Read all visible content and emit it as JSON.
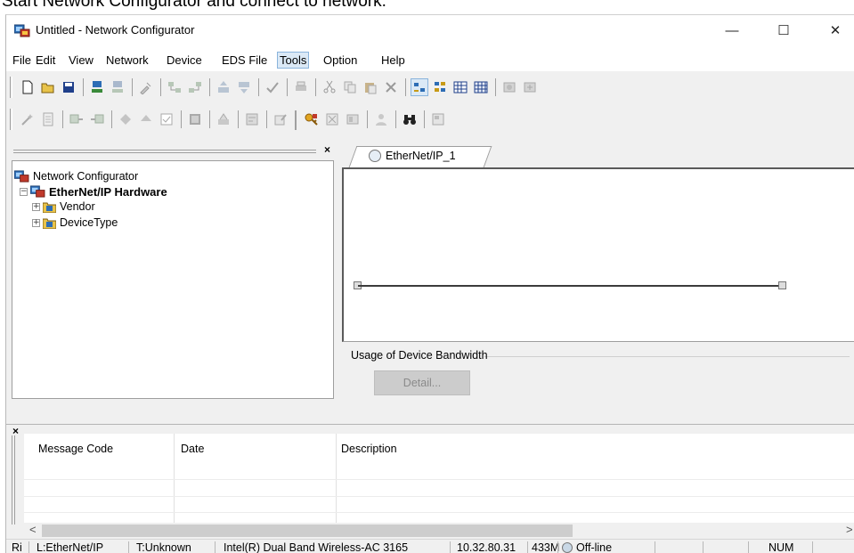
{
  "caption": "Start Network Configurator and connect to network.",
  "window": {
    "title": "Untitled - Network Configurator",
    "controls": {
      "minimize": "—",
      "maximize": "☐",
      "close": "✕"
    }
  },
  "menu": [
    "File",
    "Edit",
    "View",
    "Network",
    "Device",
    "EDS File",
    "Tools",
    "Option",
    "Help"
  ],
  "tree": {
    "root": "Network Configurator",
    "hardware": "EtherNet/IP Hardware",
    "children": [
      "Vendor",
      "DeviceType"
    ],
    "expander": "+",
    "close": "×"
  },
  "tab": {
    "label": "EtherNet/IP_1"
  },
  "bandwidth": {
    "label": "Usage of Device Bandwidth",
    "detail_button": "Detail..."
  },
  "messages": {
    "close": "×",
    "columns": [
      "Message Code",
      "Date",
      "Description"
    ],
    "scroll_left": "<",
    "scroll_right": ">"
  },
  "status": {
    "s0": "Ri",
    "s1": "L:EtherNet/IP",
    "s2": "T:Unknown",
    "s3": "Intel(R) Dual Band Wireless-AC 3165",
    "s4": "10.32.80.31",
    "s5": "433M",
    "s6": "Off-line",
    "s7": "NUM"
  },
  "icons": {
    "app": "network-configurator-icon",
    "toolbar1": [
      "new-icon",
      "open-icon",
      "save-icon",
      "connect-icon",
      "disconnect-icon",
      "tool-icon",
      "network-icon",
      "network2-icon",
      "upload-icon",
      "download-icon",
      "check-icon",
      "print-icon",
      "cut-icon",
      "copy-icon",
      "paste-icon",
      "delete-icon",
      "view-icon",
      "view2-icon",
      "grid-icon",
      "grid2-icon",
      "device-icon",
      "device2-icon"
    ],
    "toolbar2": [
      "wizard-icon",
      "doc-icon",
      "param-icon",
      "param2-icon",
      "arrow-icon",
      "arrow2-icon",
      "checkbox-icon",
      "monitor-icon",
      "parameter-icon",
      "register-icon",
      "edit-icon",
      "key-icon",
      "error-icon",
      "io-icon",
      "person-icon",
      "binoculars-icon",
      "properties-icon"
    ]
  },
  "colors": {
    "window_bg": "#f0f0f0",
    "menu_active": "#dbe9f6",
    "accent_border": "#8ab4dc"
  }
}
